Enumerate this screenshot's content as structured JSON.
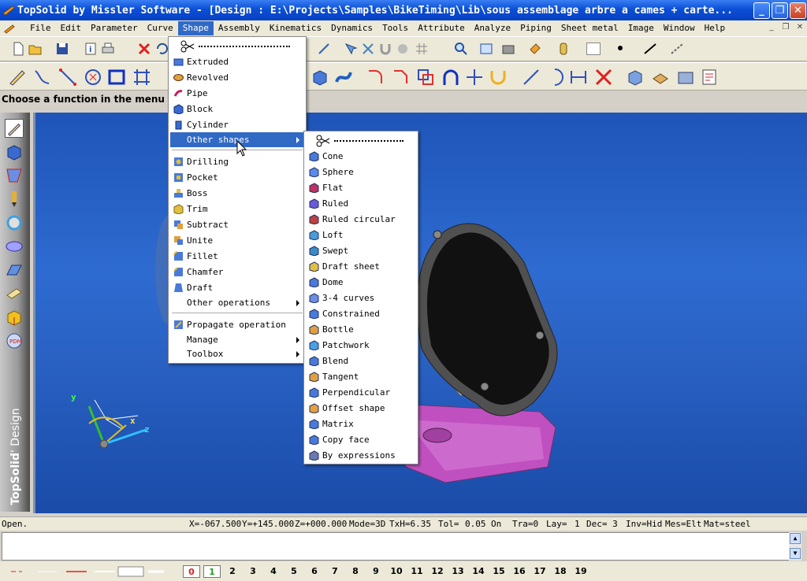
{
  "title": "TopSolid by Missler Software - [Design : E:\\Projects\\Samples\\BikeTiming\\Lib\\sous assemblage arbre a cames + carte...",
  "menu": [
    "File",
    "Edit",
    "Parameter",
    "Curve",
    "Shape",
    "Assembly",
    "Kinematics",
    "Dynamics",
    "Tools",
    "Attribute",
    "Analyze",
    "Piping",
    "Sheet metal",
    "Image",
    "Window",
    "Help"
  ],
  "prompt": "Choose a function in the menu",
  "shape_menu": {
    "items": [
      "Extruded",
      "Revolved",
      "Pipe",
      "Block",
      "Cylinder",
      "Other shapes"
    ],
    "items2": [
      "Drilling",
      "Pocket",
      "Boss",
      "Trim",
      "Subtract",
      "Unite",
      "Fillet",
      "Chamfer",
      "Draft",
      "Other operations"
    ],
    "items3": [
      "Propagate operation",
      "Manage",
      "Toolbox"
    ]
  },
  "other_shapes_menu": [
    "Cone",
    "Sphere",
    "Flat",
    "Ruled",
    "Ruled circular",
    "Loft",
    "Swept",
    "Draft sheet",
    "Dome",
    "3-4 curves",
    "Constrained",
    "Bottle",
    "Patchwork",
    "Blend",
    "Tangent",
    "Perpendicular",
    "Offset shape",
    "Matrix",
    "Copy face",
    "By expressions"
  ],
  "brand": {
    "bold": "TopSolid",
    "rest": "' Design"
  },
  "axes": {
    "x": "x",
    "y": "y",
    "z": "z"
  },
  "status": {
    "state": "Open.",
    "x": "X=-067.500",
    "y": "Y=+145.000",
    "z": "Z=+000.000",
    "mode": "Mode=3D",
    "txh": "TxH=6.35",
    "tol_label": "Tol=",
    "tol": "0.05",
    "on": "On",
    "tra": "Tra=0",
    "lay_label": "Lay=",
    "lay": "1",
    "dec": "Dec= 3",
    "inv": "Inv=Hid",
    "mes": "Mes=Elt",
    "mat": "Mat=steel"
  },
  "layers": [
    "0",
    "1",
    "2",
    "3",
    "4",
    "5",
    "6",
    "7",
    "8",
    "9",
    "10",
    "11",
    "12",
    "13",
    "14",
    "15",
    "16",
    "17",
    "18",
    "19"
  ],
  "colors": {
    "accent": "#316ac5",
    "title": "#0a4fd6",
    "viewport": "#2a62c4"
  }
}
